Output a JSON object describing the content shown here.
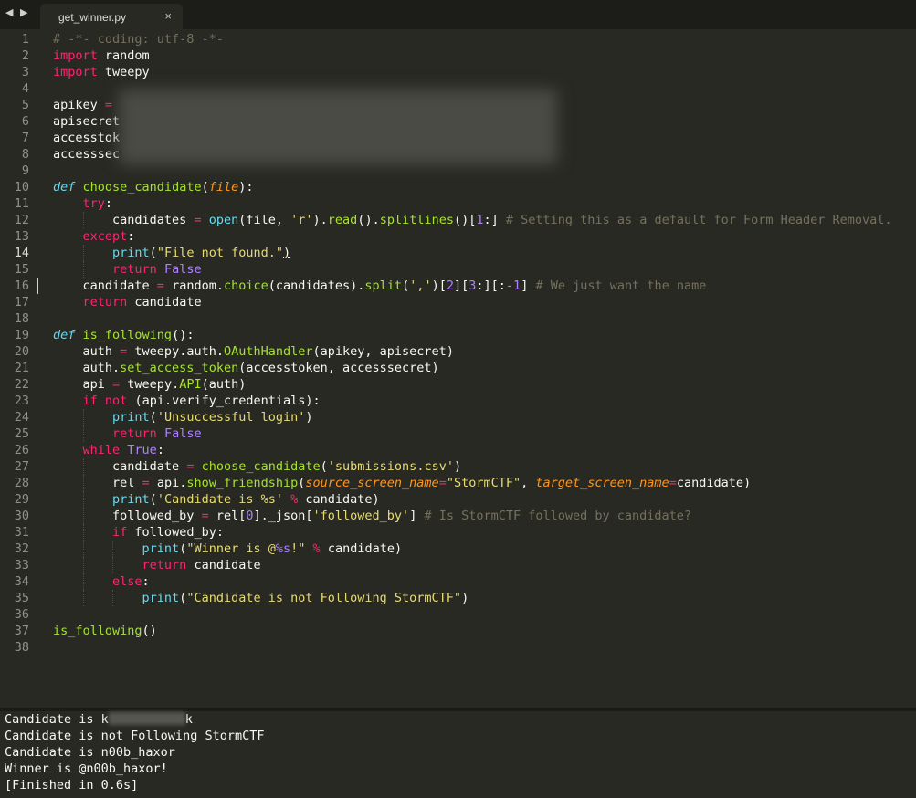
{
  "tab": {
    "title": "get_winner.py",
    "close": "×",
    "nav": "◀ ▶"
  },
  "editor": {
    "active_line": 14,
    "modified_line": 16,
    "lines": [
      [
        [
          "# -*- coding: utf-8 -*-",
          "c"
        ]
      ],
      [
        [
          "import",
          "k"
        ],
        [
          " random",
          ""
        ]
      ],
      [
        [
          "import",
          "k"
        ],
        [
          " tweepy",
          ""
        ]
      ],
      [],
      [
        [
          "apikey ",
          ""
        ],
        [
          "=",
          "k"
        ]
      ],
      [
        [
          "apisecret",
          ""
        ]
      ],
      [
        [
          "accesstok",
          ""
        ]
      ],
      [
        [
          "accesssec",
          ""
        ]
      ],
      [],
      [
        [
          "def",
          "d"
        ],
        [
          " ",
          ""
        ],
        [
          "choose_candidate",
          "f"
        ],
        [
          "(",
          ""
        ],
        [
          "file",
          "p"
        ],
        [
          "):",
          ""
        ]
      ],
      [
        [
          "    ",
          ""
        ],
        [
          "try",
          "k"
        ],
        [
          ":",
          ""
        ]
      ],
      [
        [
          "        candidates ",
          ""
        ],
        [
          "=",
          "k"
        ],
        [
          " ",
          ""
        ],
        [
          "open",
          "b"
        ],
        [
          "(file, ",
          ""
        ],
        [
          "'r'",
          "s"
        ],
        [
          ").",
          ""
        ],
        [
          "read",
          "f"
        ],
        [
          "().",
          ""
        ],
        [
          "splitlines",
          "f"
        ],
        [
          "()[",
          ""
        ],
        [
          "1",
          "n"
        ],
        [
          ":] ",
          ""
        ],
        [
          "# Setting this as a default for Form Header Removal.",
          "c"
        ]
      ],
      [
        [
          "    ",
          ""
        ],
        [
          "except",
          "k"
        ],
        [
          ":",
          ""
        ]
      ],
      [
        [
          "        ",
          ""
        ],
        [
          "print",
          "b"
        ],
        [
          "(",
          ""
        ],
        [
          "\"File not found.\"",
          "s"
        ],
        [
          ")",
          "u"
        ]
      ],
      [
        [
          "        ",
          ""
        ],
        [
          "return",
          "k"
        ],
        [
          " ",
          ""
        ],
        [
          "False",
          "n"
        ]
      ],
      [
        [
          "    candidate ",
          ""
        ],
        [
          "=",
          "k"
        ],
        [
          " random.",
          ""
        ],
        [
          "choice",
          "f"
        ],
        [
          "(candidates).",
          ""
        ],
        [
          "split",
          "f"
        ],
        [
          "(",
          ""
        ],
        [
          "','",
          "s"
        ],
        [
          ")[",
          ""
        ],
        [
          "2",
          "n"
        ],
        [
          "][",
          ""
        ],
        [
          "3",
          "n"
        ],
        [
          ":][:",
          ""
        ],
        [
          "-1",
          "n"
        ],
        [
          "] ",
          ""
        ],
        [
          "# We just want the name",
          "c"
        ]
      ],
      [
        [
          "    ",
          ""
        ],
        [
          "return",
          "k"
        ],
        [
          " candidate",
          ""
        ]
      ],
      [],
      [
        [
          "def",
          "d"
        ],
        [
          " ",
          ""
        ],
        [
          "is_following",
          "f"
        ],
        [
          "():",
          ""
        ]
      ],
      [
        [
          "    auth ",
          ""
        ],
        [
          "=",
          "k"
        ],
        [
          " tweepy.auth.",
          ""
        ],
        [
          "OAuthHandler",
          "f"
        ],
        [
          "(apikey, apisecret)",
          ""
        ]
      ],
      [
        [
          "    auth.",
          ""
        ],
        [
          "set_access_token",
          "f"
        ],
        [
          "(accesstoken, accesssecret)",
          ""
        ]
      ],
      [
        [
          "    api ",
          ""
        ],
        [
          "=",
          "k"
        ],
        [
          " tweepy.",
          ""
        ],
        [
          "API",
          "f"
        ],
        [
          "(auth)",
          ""
        ]
      ],
      [
        [
          "    ",
          ""
        ],
        [
          "if",
          "k"
        ],
        [
          " ",
          ""
        ],
        [
          "not",
          "k"
        ],
        [
          " (api.verify_credentials):",
          ""
        ]
      ],
      [
        [
          "        ",
          ""
        ],
        [
          "print",
          "b"
        ],
        [
          "(",
          ""
        ],
        [
          "'Unsuccessful login'",
          "s"
        ],
        [
          ")",
          ""
        ]
      ],
      [
        [
          "        ",
          ""
        ],
        [
          "return",
          "k"
        ],
        [
          " ",
          ""
        ],
        [
          "False",
          "n"
        ]
      ],
      [
        [
          "    ",
          ""
        ],
        [
          "while",
          "k"
        ],
        [
          " ",
          ""
        ],
        [
          "True",
          "n"
        ],
        [
          ":",
          ""
        ]
      ],
      [
        [
          "        candidate ",
          ""
        ],
        [
          "=",
          "k"
        ],
        [
          " ",
          ""
        ],
        [
          "choose_candidate",
          "f"
        ],
        [
          "(",
          ""
        ],
        [
          "'submissions.csv'",
          "s"
        ],
        [
          ")",
          ""
        ]
      ],
      [
        [
          "        rel ",
          ""
        ],
        [
          "=",
          "k"
        ],
        [
          " api.",
          ""
        ],
        [
          "show_friendship",
          "f"
        ],
        [
          "(",
          ""
        ],
        [
          "source_screen_name",
          "p"
        ],
        [
          "=",
          "k"
        ],
        [
          "\"StormCTF\"",
          "s"
        ],
        [
          ", ",
          ""
        ],
        [
          "target_screen_name",
          "p"
        ],
        [
          "=",
          "k"
        ],
        [
          "candidate)",
          ""
        ]
      ],
      [
        [
          "        ",
          ""
        ],
        [
          "print",
          "b"
        ],
        [
          "(",
          ""
        ],
        [
          "'Candidate is %s'",
          "s"
        ],
        [
          " ",
          ""
        ],
        [
          "%",
          "k"
        ],
        [
          " candidate)",
          ""
        ]
      ],
      [
        [
          "        followed_by ",
          ""
        ],
        [
          "=",
          "k"
        ],
        [
          " rel[",
          ""
        ],
        [
          "0",
          "n"
        ],
        [
          "]._json[",
          ""
        ],
        [
          "'followed_by'",
          "s"
        ],
        [
          "] ",
          ""
        ],
        [
          "# Is StormCTF followed by candidate?",
          "c"
        ]
      ],
      [
        [
          "        ",
          ""
        ],
        [
          "if",
          "k"
        ],
        [
          " followed_by:",
          ""
        ]
      ],
      [
        [
          "            ",
          ""
        ],
        [
          "print",
          "b"
        ],
        [
          "(",
          ""
        ],
        [
          "\"Winner is @",
          "s"
        ],
        [
          "%s",
          "n"
        ],
        [
          "!\"",
          "s"
        ],
        [
          " ",
          ""
        ],
        [
          "%",
          "k"
        ],
        [
          " candidate)",
          ""
        ]
      ],
      [
        [
          "            ",
          ""
        ],
        [
          "return",
          "k"
        ],
        [
          " candidate",
          ""
        ]
      ],
      [
        [
          "        ",
          ""
        ],
        [
          "else",
          "k"
        ],
        [
          ":",
          ""
        ]
      ],
      [
        [
          "            ",
          ""
        ],
        [
          "print",
          "b"
        ],
        [
          "(",
          ""
        ],
        [
          "\"Candidate is not Following StormCTF\"",
          "s"
        ],
        [
          ")",
          ""
        ]
      ],
      [],
      [
        [
          "is_following",
          "f"
        ],
        [
          "()",
          ""
        ]
      ],
      []
    ]
  },
  "console": {
    "lines": [
      "Candidate is k",
      "Candidate is not Following StormCTF",
      "Candidate is n00b_haxor",
      "Winner is @n00b_haxor!",
      "[Finished in 0.6s]"
    ],
    "redacted_suffix": "k"
  },
  "colors": {
    "background": "#282923",
    "comment": "#75715e",
    "keyword": "#f92672",
    "function": "#a6e22e",
    "string": "#e6db74",
    "number": "#ae81ff",
    "builtin": "#66d9ef",
    "parameter": "#fd971f"
  }
}
